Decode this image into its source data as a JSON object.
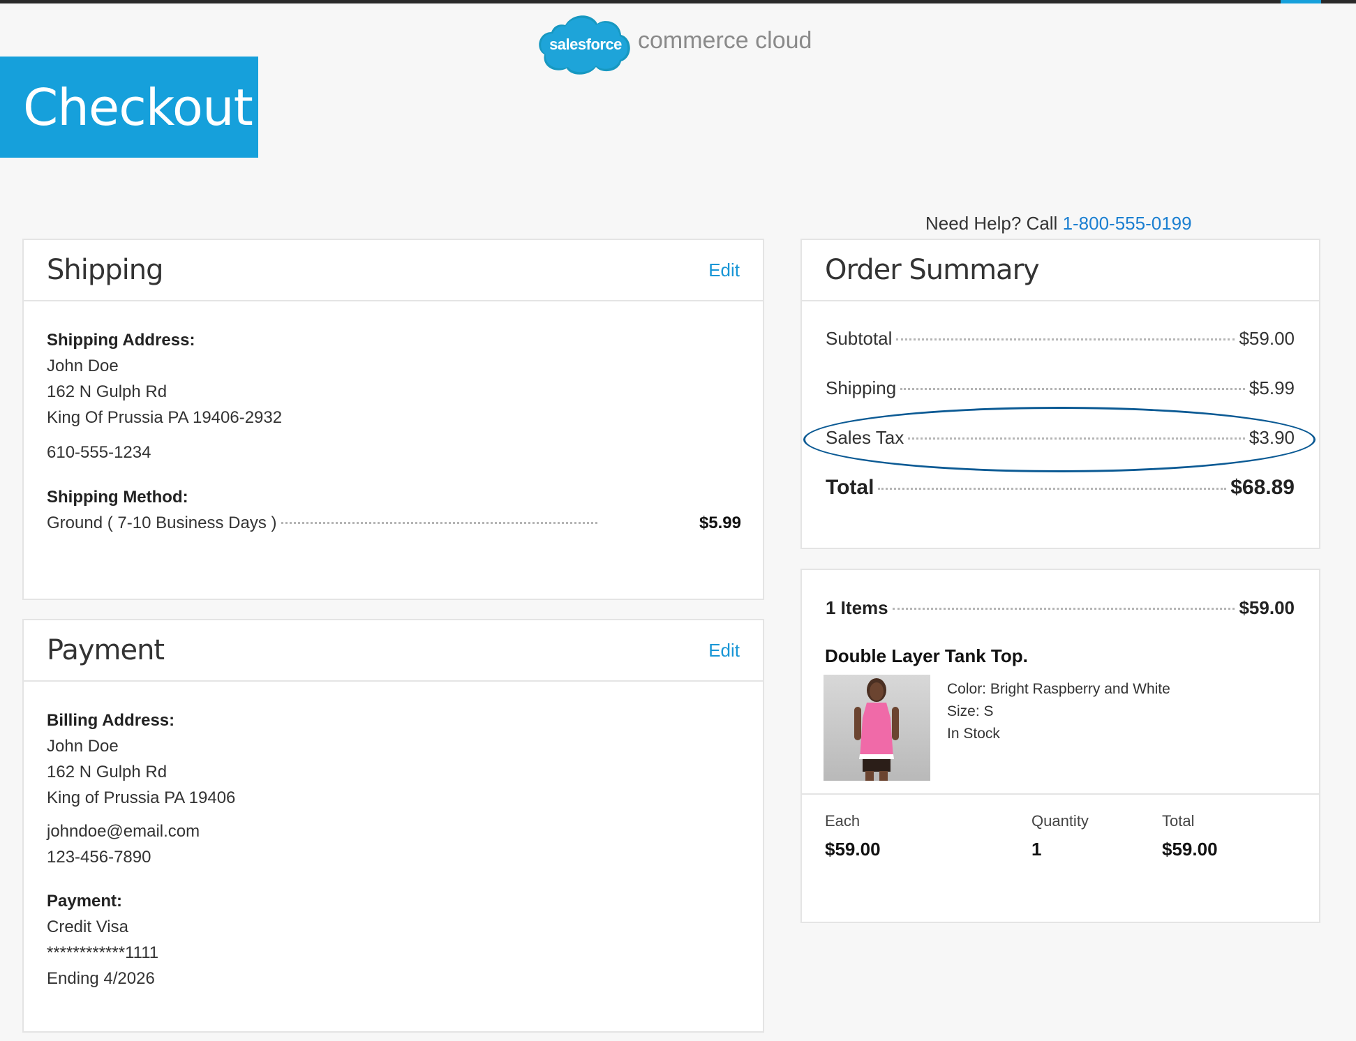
{
  "brand": {
    "cloud_text": "salesforce",
    "product_text": "commerce cloud",
    "accent_color": "#16a0db"
  },
  "page_title": "Checkout",
  "help": {
    "prefix": "Need Help? Call",
    "phone": "1-800-555-0199"
  },
  "shipping": {
    "title": "Shipping",
    "edit_label": "Edit",
    "address_label": "Shipping Address:",
    "name": "John Doe",
    "street": "162 N Gulph Rd",
    "city_line": "King Of Prussia PA 19406-2932",
    "phone": "610-555-1234",
    "method_label": "Shipping Method:",
    "method_name": "Ground",
    "method_detail": "( 7-10 Business Days )",
    "method_price": "$5.99"
  },
  "payment": {
    "title": "Payment",
    "edit_label": "Edit",
    "billing_label": "Billing Address:",
    "name": "John Doe",
    "street": "162 N Gulph Rd",
    "city_line": "King of Prussia PA 19406",
    "email": "johndoe@email.com",
    "phone": "123-456-7890",
    "payment_label": "Payment:",
    "method": "Credit Visa",
    "card_number": "************1111",
    "expiry": "Ending 4/2026"
  },
  "summary": {
    "title": "Order Summary",
    "subtotal_label": "Subtotal",
    "subtotal": "$59.00",
    "shipping_label": "Shipping",
    "shipping": "$5.99",
    "tax_label": "Sales Tax",
    "tax": "$3.90",
    "total_label": "Total",
    "total": "$68.89"
  },
  "items": {
    "count_label": "1 Items",
    "count_total": "$59.00",
    "product": {
      "name": "Double Layer Tank Top.",
      "color": "Color: Bright Raspberry and White",
      "size": "Size: S",
      "stock": "In Stock",
      "each_label": "Each",
      "each": "$59.00",
      "qty_label": "Quantity",
      "qty": "1",
      "total_label": "Total",
      "total": "$59.00"
    }
  },
  "annotation_color": "#0b5a94"
}
